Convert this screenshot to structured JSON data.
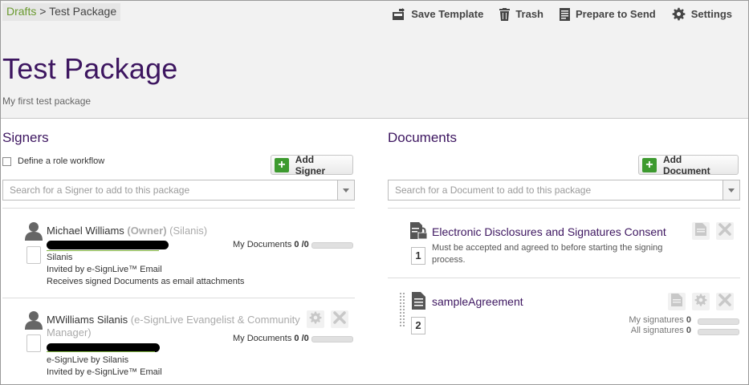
{
  "breadcrumb": {
    "parent": "Drafts",
    "separator": ">",
    "current": "Test Package"
  },
  "toolbar": {
    "save_template": "Save Template",
    "trash": "Trash",
    "prepare": "Prepare to Send",
    "settings": "Settings"
  },
  "package": {
    "title": "Test Package",
    "description": "My first test package"
  },
  "signers": {
    "heading": "Signers",
    "role_workflow_label": "Define a role workflow",
    "add_label": "Add Signer",
    "search_placeholder": "Search for a Signer to add to this package",
    "my_documents_label": "My Documents",
    "items": [
      {
        "name": "Michael Williams",
        "role": "(Owner)",
        "company_paren": "(Silanis)",
        "company": "Silanis",
        "invited": "Invited by e-SignLive™ Email",
        "extra": "Receives signed Documents as email attachments",
        "doc_count": "0",
        "doc_total": "/0",
        "signed_fraction": 0
      },
      {
        "name": "MWilliams Silanis",
        "title_line1": "(e-SignLive Evangelist & Community",
        "title_line2": "Manager)",
        "company": "e-SignLive by Silanis",
        "invited": "Invited by e-SignLive™ Email",
        "doc_count": "0",
        "doc_total": "/0",
        "signed_fraction": 0
      }
    ]
  },
  "documents": {
    "heading": "Documents",
    "add_label": "Add Document",
    "search_placeholder": "Search for a Document to add to this package",
    "items": [
      {
        "title": "Electronic Disclosures and Signatures Consent",
        "description": "Must be accepted and agreed to before starting the signing process.",
        "number": "1"
      },
      {
        "title": "sampleAgreement",
        "number": "2",
        "my_signatures_label": "My signatures",
        "my_signatures_count": "0",
        "all_signatures_label": "All signatures",
        "all_signatures_count": "0",
        "my_signed_fraction": 0,
        "all_signed_fraction": 0
      }
    ]
  },
  "colors": {
    "accent_purple": "#3d1660",
    "link_green": "#6a9a2f",
    "add_green": "#3d9a2f"
  },
  "icons": [
    "save-template-icon",
    "trash-icon",
    "prepare-to-send-icon",
    "gear-icon",
    "person-icon",
    "lock-document-icon",
    "document-icon",
    "chevron-down-icon",
    "close-icon"
  ]
}
